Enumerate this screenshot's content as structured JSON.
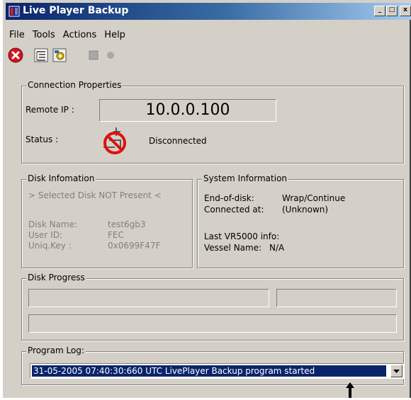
{
  "window": {
    "title": "Live Player Backup"
  },
  "title_buttons": {
    "minimize": "_",
    "maximize": "□",
    "close": "x"
  },
  "menu": [
    "File",
    "Tools",
    "Actions",
    "Help"
  ],
  "toolbar": {
    "icons": [
      "stop-red-icon",
      "tree-list-icon",
      "settings-icon",
      "stop-square-icon",
      "record-dot-icon"
    ]
  },
  "connection": {
    "group_label": "Connection Properties",
    "remote_ip_label": "Remote IP :",
    "remote_ip_value": "10.0.0.100",
    "status_label": "Status :",
    "status_value": "Disconnected"
  },
  "disk": {
    "group_label": "Disk Infomation",
    "notice": "> Selected Disk NOT Present <",
    "fields": [
      {
        "label": "Disk Name:",
        "value": "test6gb3"
      },
      {
        "label": "User ID:",
        "value": "FEC"
      },
      {
        "label": "Uniq.Key :",
        "value": "0x0699F47F"
      }
    ]
  },
  "system": {
    "group_label": "System Information",
    "end_of_disk_label": "End-of-disk:",
    "end_of_disk_value": "Wrap/Continue",
    "connected_at_label": "Connected at:",
    "connected_at_value": "(Unknown)",
    "last_info_label": "Last VR5000 info:",
    "vessel_label": "Vessel Name:",
    "vessel_value": "N/A"
  },
  "progress": {
    "group_label": "Disk Progress"
  },
  "log": {
    "group_label": "Program Log:",
    "selected": "31-05-2005 07:40:30:660 UTC LivePlayer Backup program started"
  },
  "colors": {
    "title_bar": "#0a246a",
    "window_face": "#d4d0c8",
    "selection": "#0a246a",
    "stop_red": "#d4141e"
  }
}
